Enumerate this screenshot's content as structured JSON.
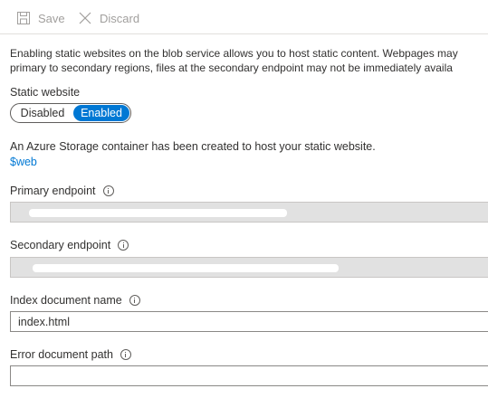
{
  "toolbar": {
    "save_label": "Save",
    "discard_label": "Discard"
  },
  "description": {
    "line1": "Enabling static websites on the blob service allows you to host static content. Webpages may",
    "line2": "primary to secondary regions, files at the secondary endpoint may not be immediately availa"
  },
  "static_website": {
    "label": "Static website",
    "options": [
      "Disabled",
      "Enabled"
    ],
    "selected": "Enabled"
  },
  "container_note": "An Azure Storage container has been created to host your static website.",
  "container_link": "$web",
  "primary_endpoint": {
    "label": "Primary endpoint",
    "value": ""
  },
  "secondary_endpoint": {
    "label": "Secondary endpoint",
    "value": ""
  },
  "index_document": {
    "label": "Index document name",
    "value": "index.html"
  },
  "error_document": {
    "label": "Error document path",
    "value": ""
  },
  "icons": {
    "save": "save-icon",
    "discard": "close-icon",
    "info": "info-icon"
  },
  "colors": {
    "accent": "#0078d4",
    "disabled_text": "#a19f9d",
    "readonly_field": "#e1e1e1"
  }
}
